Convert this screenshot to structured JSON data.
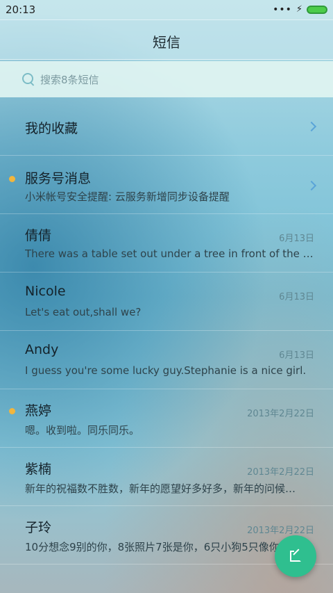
{
  "status_bar": {
    "time": "20:13",
    "signal_dots": "•••",
    "charging": "⚡"
  },
  "header": {
    "title": "短信"
  },
  "search": {
    "placeholder": "搜索8条短信"
  },
  "favorites": {
    "label": "我的收藏"
  },
  "conversations": [
    {
      "name": "服务号消息",
      "preview": "小米帐号安全提醒: 云服务新增同步设备提醒",
      "date": "",
      "unread": true
    },
    {
      "name": "倩倩",
      "preview": "There was a table set out under a tree in front of the ho…",
      "date": "6月13日",
      "unread": false
    },
    {
      "name": "Nicole",
      "preview": "Let's eat out,shall we?",
      "date": "6月13日",
      "unread": false
    },
    {
      "name": "Andy",
      "preview": "I guess you're some lucky guy.Stephanie is a nice girl.",
      "date": "6月13日",
      "unread": false
    },
    {
      "name": "燕婷",
      "preview": "嗯。收到啦。同乐同乐。",
      "date": "2013年2月22日",
      "unread": true
    },
    {
      "name": "紫楠",
      "preview": "新年的祝福数不胜数，新年的愿望好多好多，新年的问候…",
      "date": "2013年2月22日",
      "unread": false
    },
    {
      "name": "子玲",
      "preview": "10分想念9别的你，8张照片7张是你，6只小狗5只像你",
      "date": "2013年2月22日",
      "unread": false
    }
  ],
  "colors": {
    "accent": "#2fbf8f",
    "unread_dot": "#f2b63d",
    "chevron": "#5aa4d8",
    "battery": "#4ccc4a"
  },
  "icons": {
    "search": "search-icon",
    "compose": "compose-icon",
    "chevron": "chevron-right-icon"
  }
}
